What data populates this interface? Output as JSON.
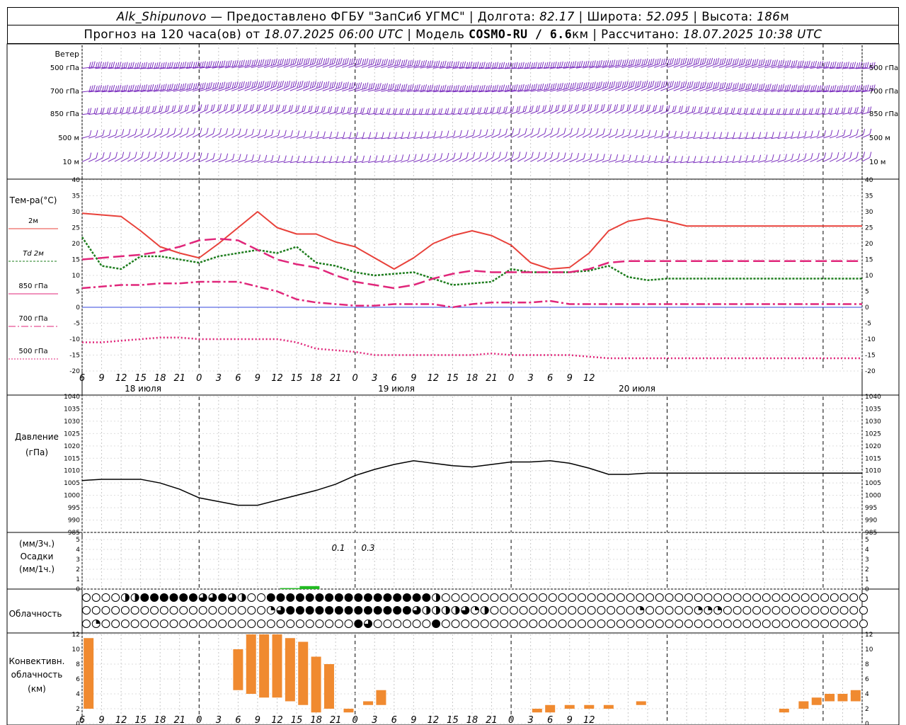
{
  "header": {
    "station": "Alk_Shipunovo",
    "provider": "— Предоставлено ФГБУ \"ЗапСиб УГМС\"",
    "lon_label": "Долгота:",
    "lon_value": "82.17",
    "lat_label": "Широта:",
    "lat_value": "52.095",
    "alt_label": "Высота:",
    "alt_value": "186",
    "alt_unit": "м",
    "forecast_prefix": "Прогноз на 120 часа(ов) от",
    "forecast_time": "18.07.2025 06:00 UTC",
    "model_label": "Модель",
    "model_name": "COSMO-RU / 6.6",
    "model_unit": "км",
    "calc_label": "Рассчитано:",
    "calc_time": "18.07.2025 10:38 UTC"
  },
  "wind_panel": {
    "title": "Ветер",
    "levels": [
      "500 гПа",
      "700 гПа",
      "850 гПа",
      "500 м",
      "10  м"
    ]
  },
  "temp_panel": {
    "title": "Тем-ра(°С)",
    "legend": [
      {
        "label": "2м",
        "color": "#e8413a"
      },
      {
        "label": "Td  2м",
        "color": "#1e7d1e"
      },
      {
        "label": "850 гПа",
        "color": "#e0267a"
      },
      {
        "label": "700 гПа",
        "color": "#e0267a"
      },
      {
        "label": "500 гПа",
        "color": "#e0267a"
      }
    ],
    "y_ticks": [
      "40",
      "35",
      "30",
      "25",
      "20",
      "15",
      "10",
      "5",
      "0",
      "-5",
      "-10",
      "-15",
      "-20"
    ]
  },
  "time_axis": {
    "hour_ticks": [
      "6",
      "9",
      "12",
      "15",
      "18",
      "21",
      "0",
      "3",
      "6",
      "9",
      "12",
      "15",
      "18",
      "21",
      "0",
      "3",
      "6",
      "9",
      "12",
      "15",
      "18",
      "21",
      "0",
      "3",
      "6",
      "9",
      "12"
    ],
    "day_labels": [
      "18 июля",
      "19 июля",
      "20 июля"
    ]
  },
  "pressure_panel": {
    "title_line1": "Давление",
    "title_line2": "(гПа)",
    "y_ticks": [
      "1040",
      "1035",
      "1030",
      "1025",
      "1020",
      "1015",
      "1010",
      "1005",
      "1000",
      "995",
      "990",
      "985"
    ]
  },
  "precip_panel": {
    "unit_3h": "(мм/3ч.)",
    "title": "Осадки",
    "unit_1h": "(мм/1ч.)",
    "y_ticks": [
      "5",
      "4",
      "3",
      "2",
      "1",
      "0"
    ],
    "annotations": [
      "0.1",
      "0.3"
    ]
  },
  "cloud_panel": {
    "title": "Облачность"
  },
  "conv_panel": {
    "title_line1": "Конвективн.",
    "title_line2": "облачность",
    "title_line3": "(км)",
    "y_ticks": [
      "12",
      "10",
      "8",
      "6",
      "4",
      "2",
      "0"
    ]
  },
  "colors": {
    "wind": "#7b2fbe",
    "t2m": "#e8413a",
    "td2m": "#1e7d1e",
    "levels": "#e0267a",
    "zero_line": "#3344dd",
    "pressure": "#000000",
    "precip": "#22bb22",
    "convective": "#f08a30"
  },
  "chart_data": [
    {
      "type": "line",
      "x": [
        6,
        9,
        12,
        15,
        18,
        21,
        24,
        27,
        30,
        33,
        36,
        39,
        42,
        45,
        48,
        51,
        54,
        57,
        60,
        63,
        66,
        69,
        72,
        75,
        78,
        81,
        84,
        87,
        90,
        93,
        96,
        99,
        102,
        105,
        108,
        111,
        114,
        117,
        120,
        123,
        126
      ],
      "series": [
        {
          "name": "2м",
          "values": [
            29.5,
            29,
            28.5,
            24,
            19,
            17,
            15.5,
            20,
            25,
            30,
            25,
            23,
            23,
            20.5,
            19,
            15.5,
            12,
            15.5,
            20,
            22.5,
            24,
            22.5,
            19.5,
            14,
            12,
            12.5,
            17,
            24,
            27,
            28,
            27,
            25.5,
            25.5,
            25.5,
            25.5,
            25.5,
            25.5,
            25.5,
            25.5,
            25.5,
            25.5
          ]
        },
        {
          "name": "Td  2м",
          "values": [
            22,
            13,
            12,
            16,
            16,
            15,
            14,
            16,
            17,
            18,
            17,
            19,
            14,
            13,
            11,
            10,
            10.5,
            11,
            9,
            7,
            7.5,
            8,
            12,
            11,
            11,
            11,
            11.5,
            13,
            9.5,
            8.5,
            9,
            9,
            9,
            9,
            9,
            9,
            9,
            9,
            9,
            9,
            9
          ]
        },
        {
          "name": "850 гПа",
          "values": [
            15,
            15.5,
            16,
            16.5,
            17.5,
            19,
            21,
            21.5,
            21,
            18,
            15,
            13.5,
            12.5,
            10,
            8,
            7,
            6,
            7,
            9,
            10.5,
            11.5,
            11,
            11,
            11,
            11,
            11,
            12,
            14,
            14.5,
            14.5,
            14.5,
            14.5,
            14.5,
            14.5,
            14.5,
            14.5,
            14.5,
            14.5,
            14.5,
            14.5,
            14.5
          ]
        },
        {
          "name": "700 гПа",
          "values": [
            6,
            6.5,
            7,
            7,
            7.5,
            7.5,
            8,
            8,
            8,
            6.5,
            5,
            2.5,
            1.5,
            1,
            0.5,
            0.5,
            1,
            1,
            1,
            0,
            1,
            1.5,
            1.5,
            1.5,
            2,
            1,
            1,
            1,
            1,
            1,
            1,
            1,
            1,
            1,
            1,
            1,
            1,
            1,
            1,
            1,
            1
          ]
        },
        {
          "name": "500 гПа",
          "values": [
            -11,
            -11,
            -10.5,
            -10,
            -9.5,
            -9.5,
            -10,
            -10,
            -10,
            -10,
            -10,
            -11,
            -13,
            -13.5,
            -14,
            -15,
            -15,
            -15,
            -15,
            -15,
            -15,
            -14.5,
            -15,
            -15,
            -15,
            -15,
            -15.5,
            -16,
            -16,
            -16,
            -16,
            -16,
            -16,
            -16,
            -16,
            -16,
            -16,
            -16,
            -16,
            -16,
            -16
          ]
        }
      ],
      "ylabel": "Тем-ра(°С)",
      "ylim": [
        -20,
        40
      ]
    },
    {
      "type": "line",
      "x": [
        6,
        9,
        12,
        15,
        18,
        21,
        24,
        27,
        30,
        33,
        36,
        39,
        42,
        45,
        48,
        51,
        54,
        57,
        60,
        63,
        66,
        69,
        72,
        75,
        78,
        81,
        84,
        87,
        90,
        93,
        96,
        99,
        102,
        105,
        108,
        111,
        114,
        117,
        120,
        123,
        126
      ],
      "series": [
        {
          "name": "Давление",
          "values": [
            1006,
            1006.5,
            1006.5,
            1006.5,
            1005,
            1002.5,
            999,
            997.5,
            996,
            996,
            998,
            1000,
            1002,
            1004.5,
            1008,
            1010.5,
            1012.5,
            1014,
            1013,
            1012,
            1011.5,
            1012.5,
            1013.5,
            1013.5,
            1014,
            1013,
            1011,
            1008.5,
            1008.5,
            1009,
            1009,
            1009,
            1009,
            1009,
            1009,
            1009,
            1009,
            1009,
            1009,
            1009,
            1009
          ]
        }
      ],
      "ylabel": "Давление (гПа)",
      "ylim": [
        985,
        1040
      ]
    },
    {
      "type": "bar",
      "x": [
        38,
        41
      ],
      "values": [
        0.1,
        0.3
      ],
      "ylabel": "Осадки",
      "ylim": [
        0,
        5
      ]
    },
    {
      "type": "bar",
      "title": "",
      "ylabel": "Конвективн. облачность (км)",
      "ylim": [
        0,
        12
      ],
      "bars": [
        {
          "x": 7,
          "base": 2,
          "top": 11.5
        },
        {
          "x": 30,
          "base": 4.5,
          "top": 10
        },
        {
          "x": 32,
          "base": 4,
          "top": 12
        },
        {
          "x": 34,
          "base": 3.5,
          "top": 12
        },
        {
          "x": 36,
          "base": 3.5,
          "top": 12
        },
        {
          "x": 38,
          "base": 3,
          "top": 11.5
        },
        {
          "x": 40,
          "base": 2.5,
          "top": 11
        },
        {
          "x": 42,
          "base": 1.5,
          "top": 9
        },
        {
          "x": 44,
          "base": 2,
          "top": 8
        },
        {
          "x": 47,
          "base": 1.5,
          "top": 2
        },
        {
          "x": 50,
          "base": 2.5,
          "top": 3
        },
        {
          "x": 52,
          "base": 2.5,
          "top": 4.5
        },
        {
          "x": 76,
          "base": 1.5,
          "top": 2
        },
        {
          "x": 78,
          "base": 1.5,
          "top": 2.5
        },
        {
          "x": 81,
          "base": 2,
          "top": 2.5
        },
        {
          "x": 84,
          "base": 2,
          "top": 2.5
        },
        {
          "x": 87,
          "base": 2,
          "top": 2.5
        },
        {
          "x": 92,
          "base": 2.5,
          "top": 3
        },
        {
          "x": 114,
          "base": 1.5,
          "top": 2
        },
        {
          "x": 117,
          "base": 2,
          "top": 3
        },
        {
          "x": 119,
          "base": 2.5,
          "top": 3.5
        },
        {
          "x": 121,
          "base": 3,
          "top": 4
        },
        {
          "x": 123,
          "base": 3,
          "top": 4
        },
        {
          "x": 125,
          "base": 3,
          "top": 4.5
        }
      ]
    },
    {
      "type": "heatmap",
      "title": "Облачность",
      "rows": [
        [
          0,
          0,
          0,
          0,
          2,
          2,
          4,
          4,
          4,
          4,
          4,
          4,
          3,
          3,
          4,
          3,
          2,
          0,
          0,
          4,
          4,
          4,
          4,
          4,
          4,
          4,
          4,
          4,
          4,
          4,
          4,
          4,
          4,
          4,
          4,
          4,
          2,
          0,
          0,
          0,
          0,
          0,
          0,
          0,
          0,
          0,
          0,
          0,
          0,
          0,
          0,
          0,
          0,
          0,
          0,
          0,
          0,
          0,
          0,
          0,
          0,
          0,
          0,
          0,
          0,
          0,
          0,
          0,
          0,
          0,
          0,
          0,
          0,
          0,
          0,
          0,
          0,
          0,
          0,
          0,
          0
        ],
        [
          0,
          0,
          0,
          0,
          0,
          0,
          0,
          0,
          0,
          0,
          0,
          0,
          0,
          0,
          0,
          0,
          0,
          0,
          0,
          1,
          3,
          4,
          4,
          4,
          4,
          4,
          4,
          4,
          4,
          4,
          4,
          4,
          4,
          4,
          3,
          2,
          2,
          2,
          2,
          3,
          1,
          2,
          0,
          0,
          0,
          0,
          0,
          0,
          0,
          0,
          0,
          0,
          0,
          0,
          0,
          0,
          0,
          1,
          0,
          0,
          0,
          0,
          0,
          1,
          1,
          1,
          0,
          0,
          0,
          0,
          0,
          0,
          0,
          0,
          0,
          0,
          0,
          0,
          0,
          0,
          0
        ],
        [
          0,
          1,
          0,
          0,
          0,
          0,
          0,
          0,
          0,
          0,
          0,
          0,
          0,
          0,
          0,
          0,
          0,
          0,
          0,
          0,
          0,
          0,
          0,
          0,
          0,
          0,
          0,
          0,
          4,
          3,
          0,
          0,
          0,
          0,
          0,
          0,
          4,
          0,
          0,
          0,
          0,
          0,
          0,
          0,
          0,
          0,
          0,
          0,
          0,
          0,
          0,
          0,
          0,
          0,
          0,
          0,
          0,
          0,
          0,
          0,
          0,
          0,
          0,
          0,
          0,
          0,
          0,
          0,
          0,
          0,
          0,
          0,
          0,
          0,
          0,
          0,
          0,
          0,
          0,
          0,
          0
        ]
      ]
    }
  ]
}
